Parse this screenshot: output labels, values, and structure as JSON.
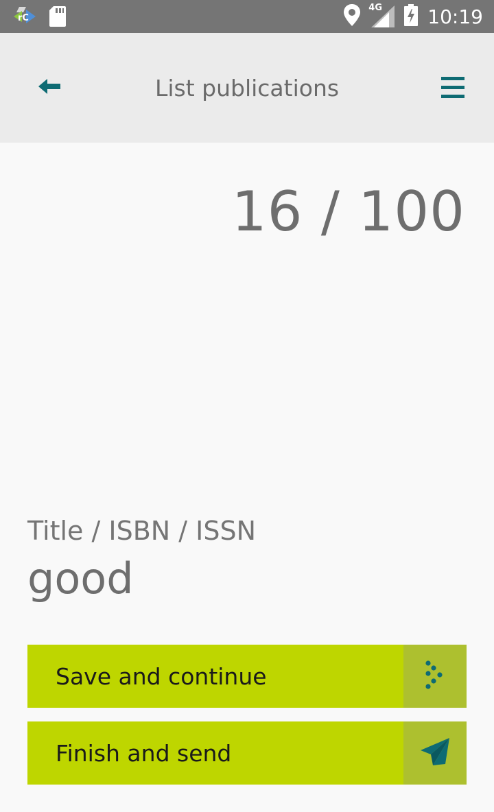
{
  "status_bar": {
    "time": "10:19",
    "network": "4G",
    "icons": [
      "app-notification-icon",
      "sd-card-icon",
      "location-pin-icon",
      "cell-signal-icon",
      "battery-charging-icon"
    ]
  },
  "app_bar": {
    "title": "List publications",
    "back_icon": "back-arrow-icon",
    "menu_icon": "hamburger-menu-icon",
    "accent_color": "#0e6b73"
  },
  "counter": {
    "text": "16 / 100",
    "current": 16,
    "total": 100
  },
  "form": {
    "field_label": "Title / ISBN / ISSN",
    "field_value": "good"
  },
  "actions": {
    "save": {
      "label": "Save and continue",
      "icon": "dots-arrow-icon"
    },
    "finish": {
      "label": "Finish and send",
      "icon": "paper-plane-icon"
    },
    "button_color": "#bed600",
    "icon_box_color": "#adc02f"
  }
}
